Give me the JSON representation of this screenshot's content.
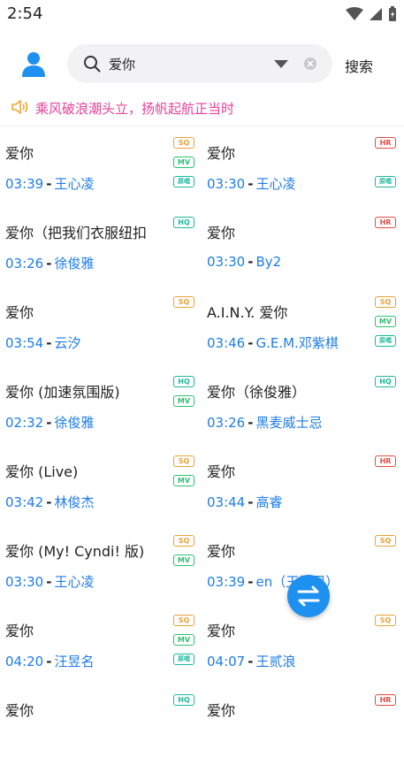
{
  "status_bar": {
    "time": "2:54"
  },
  "header": {
    "search_query": "爱你",
    "search_button": "搜索"
  },
  "notice": {
    "text": "乘风破浪潮头立，扬帆起航正当时"
  },
  "colors": {
    "accent": "#1e7ce8",
    "notice": "#e6429a",
    "fab": "#1e90f0"
  },
  "songs": [
    {
      "title": "爱你",
      "duration": "03:39",
      "artist": "王心凌",
      "badges": [
        "SQ",
        "MV",
        "原唱"
      ]
    },
    {
      "title": "爱你",
      "duration": "03:30",
      "artist": "王心凌",
      "badges": [
        "HR",
        "原唱"
      ]
    },
    {
      "title": " 爱你（把我们衣服纽扣",
      "duration": "03:26",
      "artist": "徐俊雅",
      "badges": [
        "HQ"
      ]
    },
    {
      "title": "爱你",
      "duration": "03:30",
      "artist": "By2",
      "badges": [
        "HR"
      ]
    },
    {
      "title": "爱你",
      "duration": "03:54",
      "artist": "云汐",
      "badges": [
        "SQ"
      ]
    },
    {
      "title": "A.I.N.Y. 爱你",
      "duration": "03:46",
      "artist": "G.E.M.邓紫棋",
      "badges": [
        "SQ",
        "MV",
        "原唱"
      ]
    },
    {
      "title": "爱你 (加速氛围版)",
      "duration": "02:32",
      "artist": "徐俊雅",
      "badges": [
        "HQ",
        "MV"
      ]
    },
    {
      "title": "爱你（徐俊雅）",
      "duration": "03:26",
      "artist": "黑麦威士忌",
      "badges": [
        "HQ"
      ]
    },
    {
      "title": "爱你 (Live)",
      "duration": "03:42",
      "artist": "林俊杰",
      "badges": [
        "SQ",
        "MV"
      ]
    },
    {
      "title": "爱你",
      "duration": "03:44",
      "artist": "高睿",
      "badges": [
        "HR"
      ]
    },
    {
      "title": "爱你 (My! Cyndi! 版)",
      "duration": "03:30",
      "artist": "王心凌",
      "badges": [
        "SQ",
        "MV"
      ]
    },
    {
      "title": "爱你",
      "duration": "03:39",
      "artist": "en（王婉恩）",
      "badges": [
        "SQ"
      ]
    },
    {
      "title": "爱你",
      "duration": "04:20",
      "artist": "汪昱名",
      "badges": [
        "SQ",
        "MV",
        "原唱"
      ]
    },
    {
      "title": "爱你",
      "duration": "04:07",
      "artist": "王贰浪",
      "badges": [
        "SQ"
      ]
    },
    {
      "title": "爱你",
      "duration": "",
      "artist": "",
      "badges": [
        "HQ"
      ]
    },
    {
      "title": "爱你",
      "duration": "",
      "artist": "",
      "badges": [
        "HR"
      ]
    }
  ]
}
